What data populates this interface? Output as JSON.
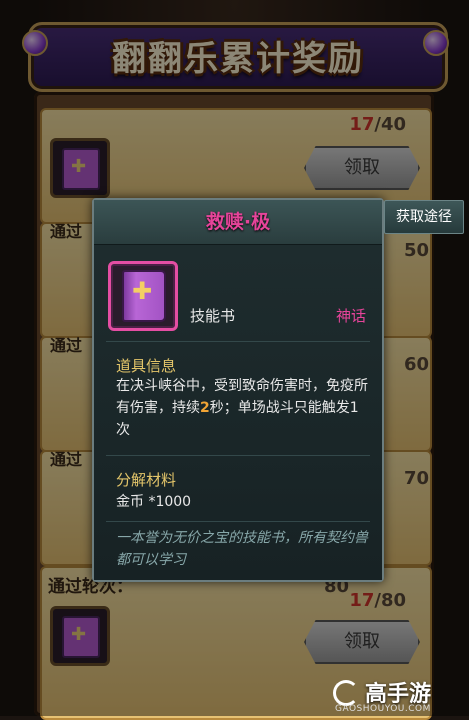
{
  "background": {
    "banner_title": "翻翻乐累计奖励",
    "rows": [
      {
        "progress_current": "17",
        "progress_total": "/40",
        "claim_label": "领取"
      },
      {
        "progress_current": "17",
        "progress_total": "/80",
        "claim_label": "领取"
      }
    ],
    "partial_labels": [
      "通过",
      "通过",
      "通过",
      "通过",
      "通过轮次："
    ],
    "partial_numbers": [
      "50",
      "60",
      "70",
      "80"
    ]
  },
  "tooltip": {
    "title": "救赎·极",
    "item_type": "技能书",
    "rarity": "神话",
    "info_label": "道具信息",
    "description_parts": [
      "在决斗峡谷中，受到致命伤害时，免疫所有伤害，持续",
      "2",
      "秒；单场战斗只能触发1次"
    ],
    "decompose_label": "分解材料",
    "decompose_value": "金币 *1000",
    "flavor_text": "一本誉为无价之宝的技能书，所有契约兽都可以学习"
  },
  "obtain_button": {
    "label": "获取途径"
  },
  "watermark": {
    "name": "高手游",
    "url": "GAOSHOUYOU.COM"
  },
  "colors": {
    "title_pink": "#e6449a",
    "info_gold": "#e3c56a",
    "highlight_orange": "#f2a535"
  },
  "icons": [
    "skill-book-icon",
    "cross-icon",
    "watermark-logo-icon"
  ]
}
